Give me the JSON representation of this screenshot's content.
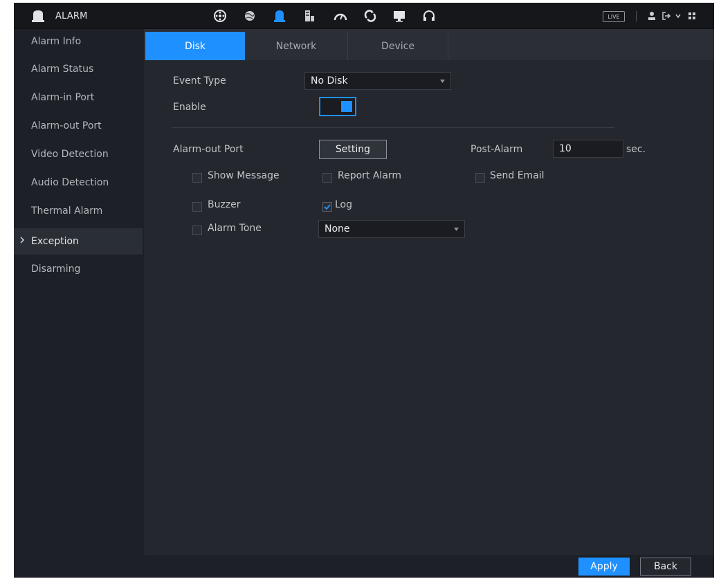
{
  "topbar": {
    "title": "ALARM",
    "live_label": "LIVE",
    "icons": [
      "camera-icon",
      "network-icon",
      "alarm-icon",
      "storage-icon",
      "dashboard-icon",
      "maintenance-icon",
      "display-icon",
      "support-icon"
    ]
  },
  "sidebar": {
    "items": [
      {
        "label": "Alarm Info"
      },
      {
        "label": "Alarm Status"
      },
      {
        "label": "Alarm-in Port"
      },
      {
        "label": "Alarm-out Port"
      },
      {
        "label": "Video Detection"
      },
      {
        "label": "Audio Detection"
      },
      {
        "label": "Thermal Alarm"
      },
      {
        "label": "Exception",
        "active": true
      },
      {
        "label": "Disarming"
      }
    ]
  },
  "tabs": [
    {
      "label": "Disk",
      "active": true
    },
    {
      "label": "Network"
    },
    {
      "label": "Device"
    }
  ],
  "form": {
    "event_type_label": "Event Type",
    "event_type_value": "No Disk",
    "enable_label": "Enable",
    "enable_value": true,
    "alarm_out_label": "Alarm-out Port",
    "setting_button": "Setting",
    "post_alarm_label": "Post-Alarm",
    "post_alarm_value": "10",
    "post_alarm_unit": "sec.",
    "show_message_label": "Show Message",
    "show_message_checked": false,
    "report_alarm_label": "Report Alarm",
    "report_alarm_checked": false,
    "send_email_label": "Send Email",
    "send_email_checked": false,
    "buzzer_label": "Buzzer",
    "buzzer_checked": false,
    "log_label": "Log",
    "log_checked": true,
    "alarm_tone_label": "Alarm Tone",
    "alarm_tone_checked": false,
    "alarm_tone_value": "None"
  },
  "footer": {
    "apply_label": "Apply",
    "back_label": "Back"
  },
  "colors": {
    "accent": "#1e90ff",
    "background": "#1d2026",
    "panel": "#24272d"
  }
}
